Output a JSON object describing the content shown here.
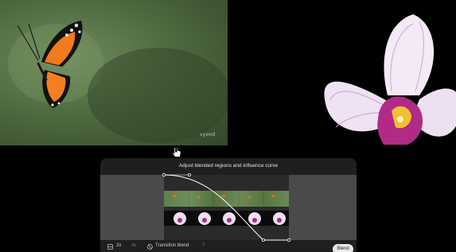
{
  "preview": {
    "left_watermark": "vyond"
  },
  "panel": {
    "title": "Adjust blended regions and influence curve"
  },
  "toolbar": {
    "speed_2x": "2x",
    "speed_4x": "4x",
    "transition_blend": "Transition blend",
    "help": "?",
    "blend_button": "Blend"
  },
  "icons": {
    "cursor": "hand-pointer-icon",
    "layout": "layout-icon",
    "transition": "transition-icon"
  }
}
